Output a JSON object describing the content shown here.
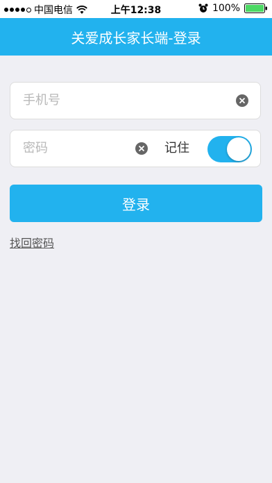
{
  "status_bar": {
    "carrier": "中国电信",
    "time": "上午12:38",
    "battery": "100%",
    "signal_bars_filled": 4,
    "signal_bars_total": 5
  },
  "header": {
    "title": "关爱成长家长端-登录"
  },
  "form": {
    "phone": {
      "placeholder": "手机号",
      "value": ""
    },
    "password": {
      "placeholder": "密码",
      "value": ""
    },
    "remember_label": "记住",
    "remember_on": true
  },
  "login_button": {
    "label": "登录"
  },
  "forgot_link": {
    "label": "找回密码"
  },
  "colors": {
    "accent": "#22b2ee",
    "background": "#efeff4",
    "battery": "#4cd964"
  },
  "icons": {
    "clear": "clear-circle-icon",
    "alarm": "alarm-icon",
    "wifi": "wifi-icon",
    "battery": "battery-icon"
  }
}
